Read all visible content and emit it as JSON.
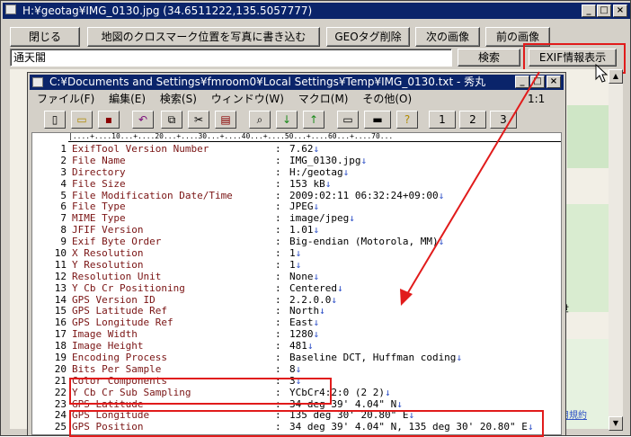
{
  "main": {
    "title": "H:¥geotag¥IMG_0130.jpg  (34.6511222,135.5057777)",
    "buttons": {
      "close": "閉じる",
      "write_cross": "地図のクロスマーク位置を写真に書き込む",
      "delete_geo": "GEOタグ削除",
      "next": "次の画像",
      "prev": "前の画像",
      "search": "検索",
      "exif": "EXIF情報表示"
    },
    "search_value": "通天閣",
    "map": {
      "label_1": "新世",
      "label_2": "ゲ",
      "link": "用規約"
    },
    "colors": {
      "title_bg": "#0a246a",
      "highlight": "#e11b1b",
      "arrow": "#e11b1b"
    }
  },
  "editor": {
    "title": "C:¥Documents and Settings¥fmroom0¥Local Settings¥Temp¥IMG_0130.txt  - 秀丸",
    "menu": [
      "ファイル(F)",
      "編集(E)",
      "検索(S)",
      "ウィンドウ(W)",
      "マクロ(M)",
      "その他(O)"
    ],
    "position": "1:1",
    "toolbar_numbers": [
      "1",
      "2",
      "3"
    ],
    "ruler": "|....+....10...+....20...+....30...+....40...+....50...+....60...+....70...",
    "lines": [
      {
        "n": "1",
        "k": "ExifTool Version Number",
        "v": "7.62"
      },
      {
        "n": "2",
        "k": "File Name",
        "v": "IMG_0130.jpg"
      },
      {
        "n": "3",
        "k": "Directory",
        "v": "H:/geotag"
      },
      {
        "n": "4",
        "k": "File Size",
        "v": "153 kB"
      },
      {
        "n": "5",
        "k": "File Modification Date/Time",
        "v": "2009:02:11 06:32:24+09:00"
      },
      {
        "n": "6",
        "k": "File Type",
        "v": "JPEG"
      },
      {
        "n": "7",
        "k": "MIME Type",
        "v": "image/jpeg"
      },
      {
        "n": "8",
        "k": "JFIF Version",
        "v": "1.01"
      },
      {
        "n": "9",
        "k": "Exif Byte Order",
        "v": "Big-endian (Motorola, MM)"
      },
      {
        "n": "10",
        "k": "X Resolution",
        "v": "1"
      },
      {
        "n": "11",
        "k": "Y Resolution",
        "v": "1"
      },
      {
        "n": "12",
        "k": "Resolution Unit",
        "v": "None"
      },
      {
        "n": "13",
        "k": "Y Cb Cr Positioning",
        "v": "Centered"
      },
      {
        "n": "14",
        "k": "GPS Version ID",
        "v": "2.2.0.0"
      },
      {
        "n": "15",
        "k": "GPS Latitude Ref",
        "v": "North"
      },
      {
        "n": "16",
        "k": "GPS Longitude Ref",
        "v": "East"
      },
      {
        "n": "17",
        "k": "Image Width",
        "v": "1280"
      },
      {
        "n": "18",
        "k": "Image Height",
        "v": "481"
      },
      {
        "n": "19",
        "k": "Encoding Process",
        "v": "Baseline DCT, Huffman coding"
      },
      {
        "n": "20",
        "k": "Bits Per Sample",
        "v": "8"
      },
      {
        "n": "21",
        "k": "Color Components",
        "v": "3"
      },
      {
        "n": "22",
        "k": "Y Cb Cr Sub Sampling",
        "v": "YCbCr4:2:0 (2 2)"
      },
      {
        "n": "23",
        "k": "GPS Latitude",
        "v": "34 deg 39' 4.04\" N"
      },
      {
        "n": "24",
        "k": "GPS Longitude",
        "v": "135 deg 30' 20.80\" E"
      },
      {
        "n": "25",
        "k": "GPS Position",
        "v": "34 deg 39' 4.04\" N, 135 deg 30' 20.80\" E"
      }
    ],
    "eol_mark": "↓",
    "colon": ":"
  }
}
